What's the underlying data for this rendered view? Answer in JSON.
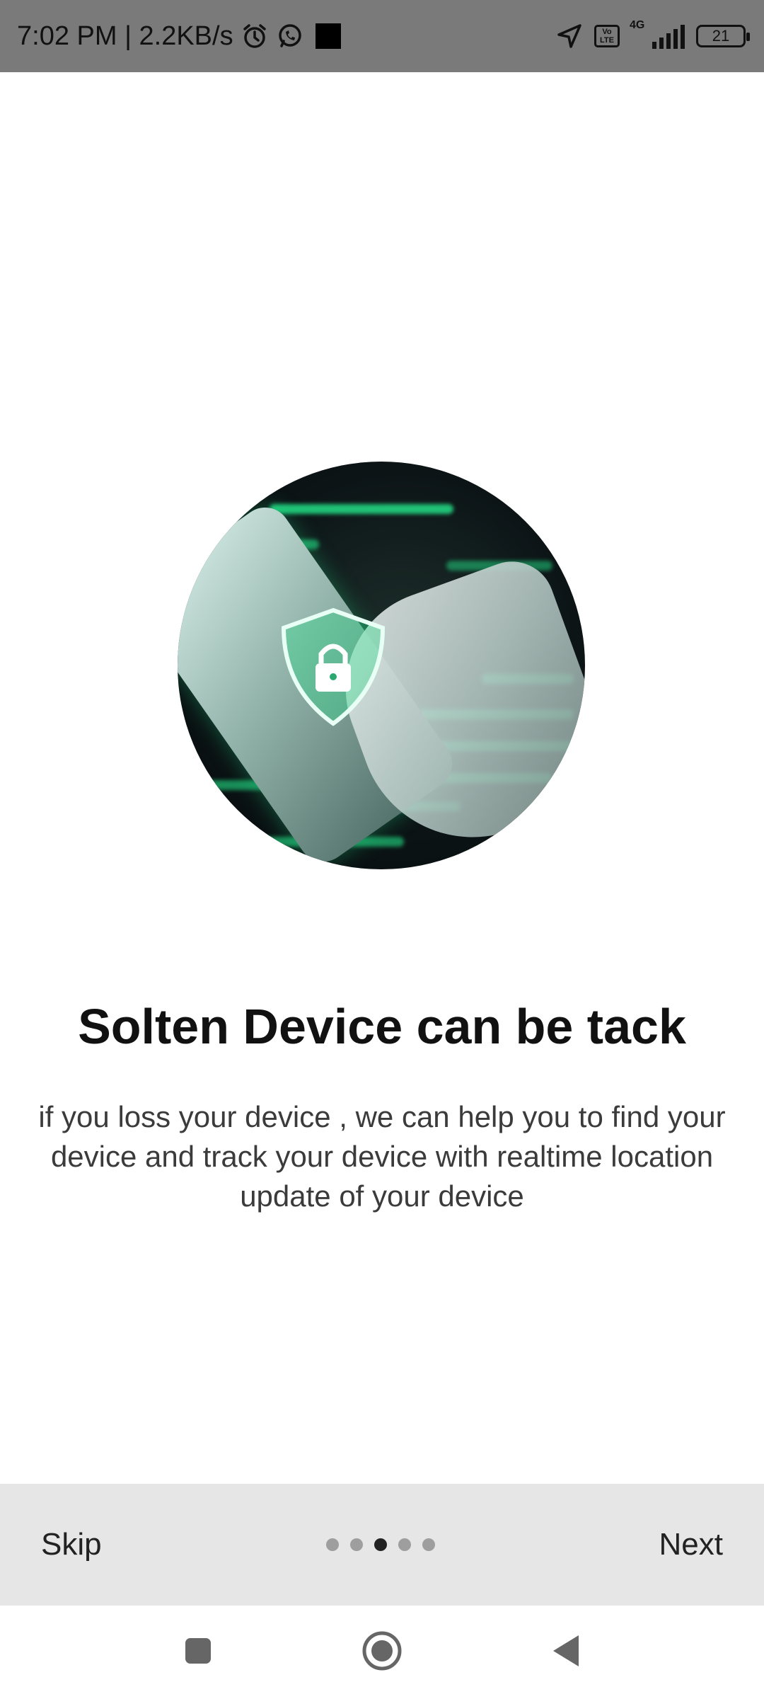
{
  "status_bar": {
    "time_speed": "7:02 PM | 2.2KB/s",
    "icons": [
      "alarm-icon",
      "whatsapp-icon",
      "stop-square-icon",
      "location-arrow-icon",
      "volte-icon",
      "signal-4g-icon",
      "battery-icon"
    ],
    "volte_top": "Vo",
    "volte_bottom": "LTE",
    "network_label": "4G",
    "battery_level": "21"
  },
  "hero": {
    "image_icon": "phone-shield-lock-illustration",
    "accent_color": "#23e087"
  },
  "content": {
    "title": "Solten Device can be tack",
    "description": "if you loss your device , we can help you to find your device and track your device with realtime location update of your device"
  },
  "onboarding": {
    "skip_label": "Skip",
    "next_label": "Next",
    "page_count": 5,
    "current_page": 3
  },
  "nav_bar": {
    "icons": [
      "recent-apps-icon",
      "home-icon",
      "back-icon"
    ]
  }
}
